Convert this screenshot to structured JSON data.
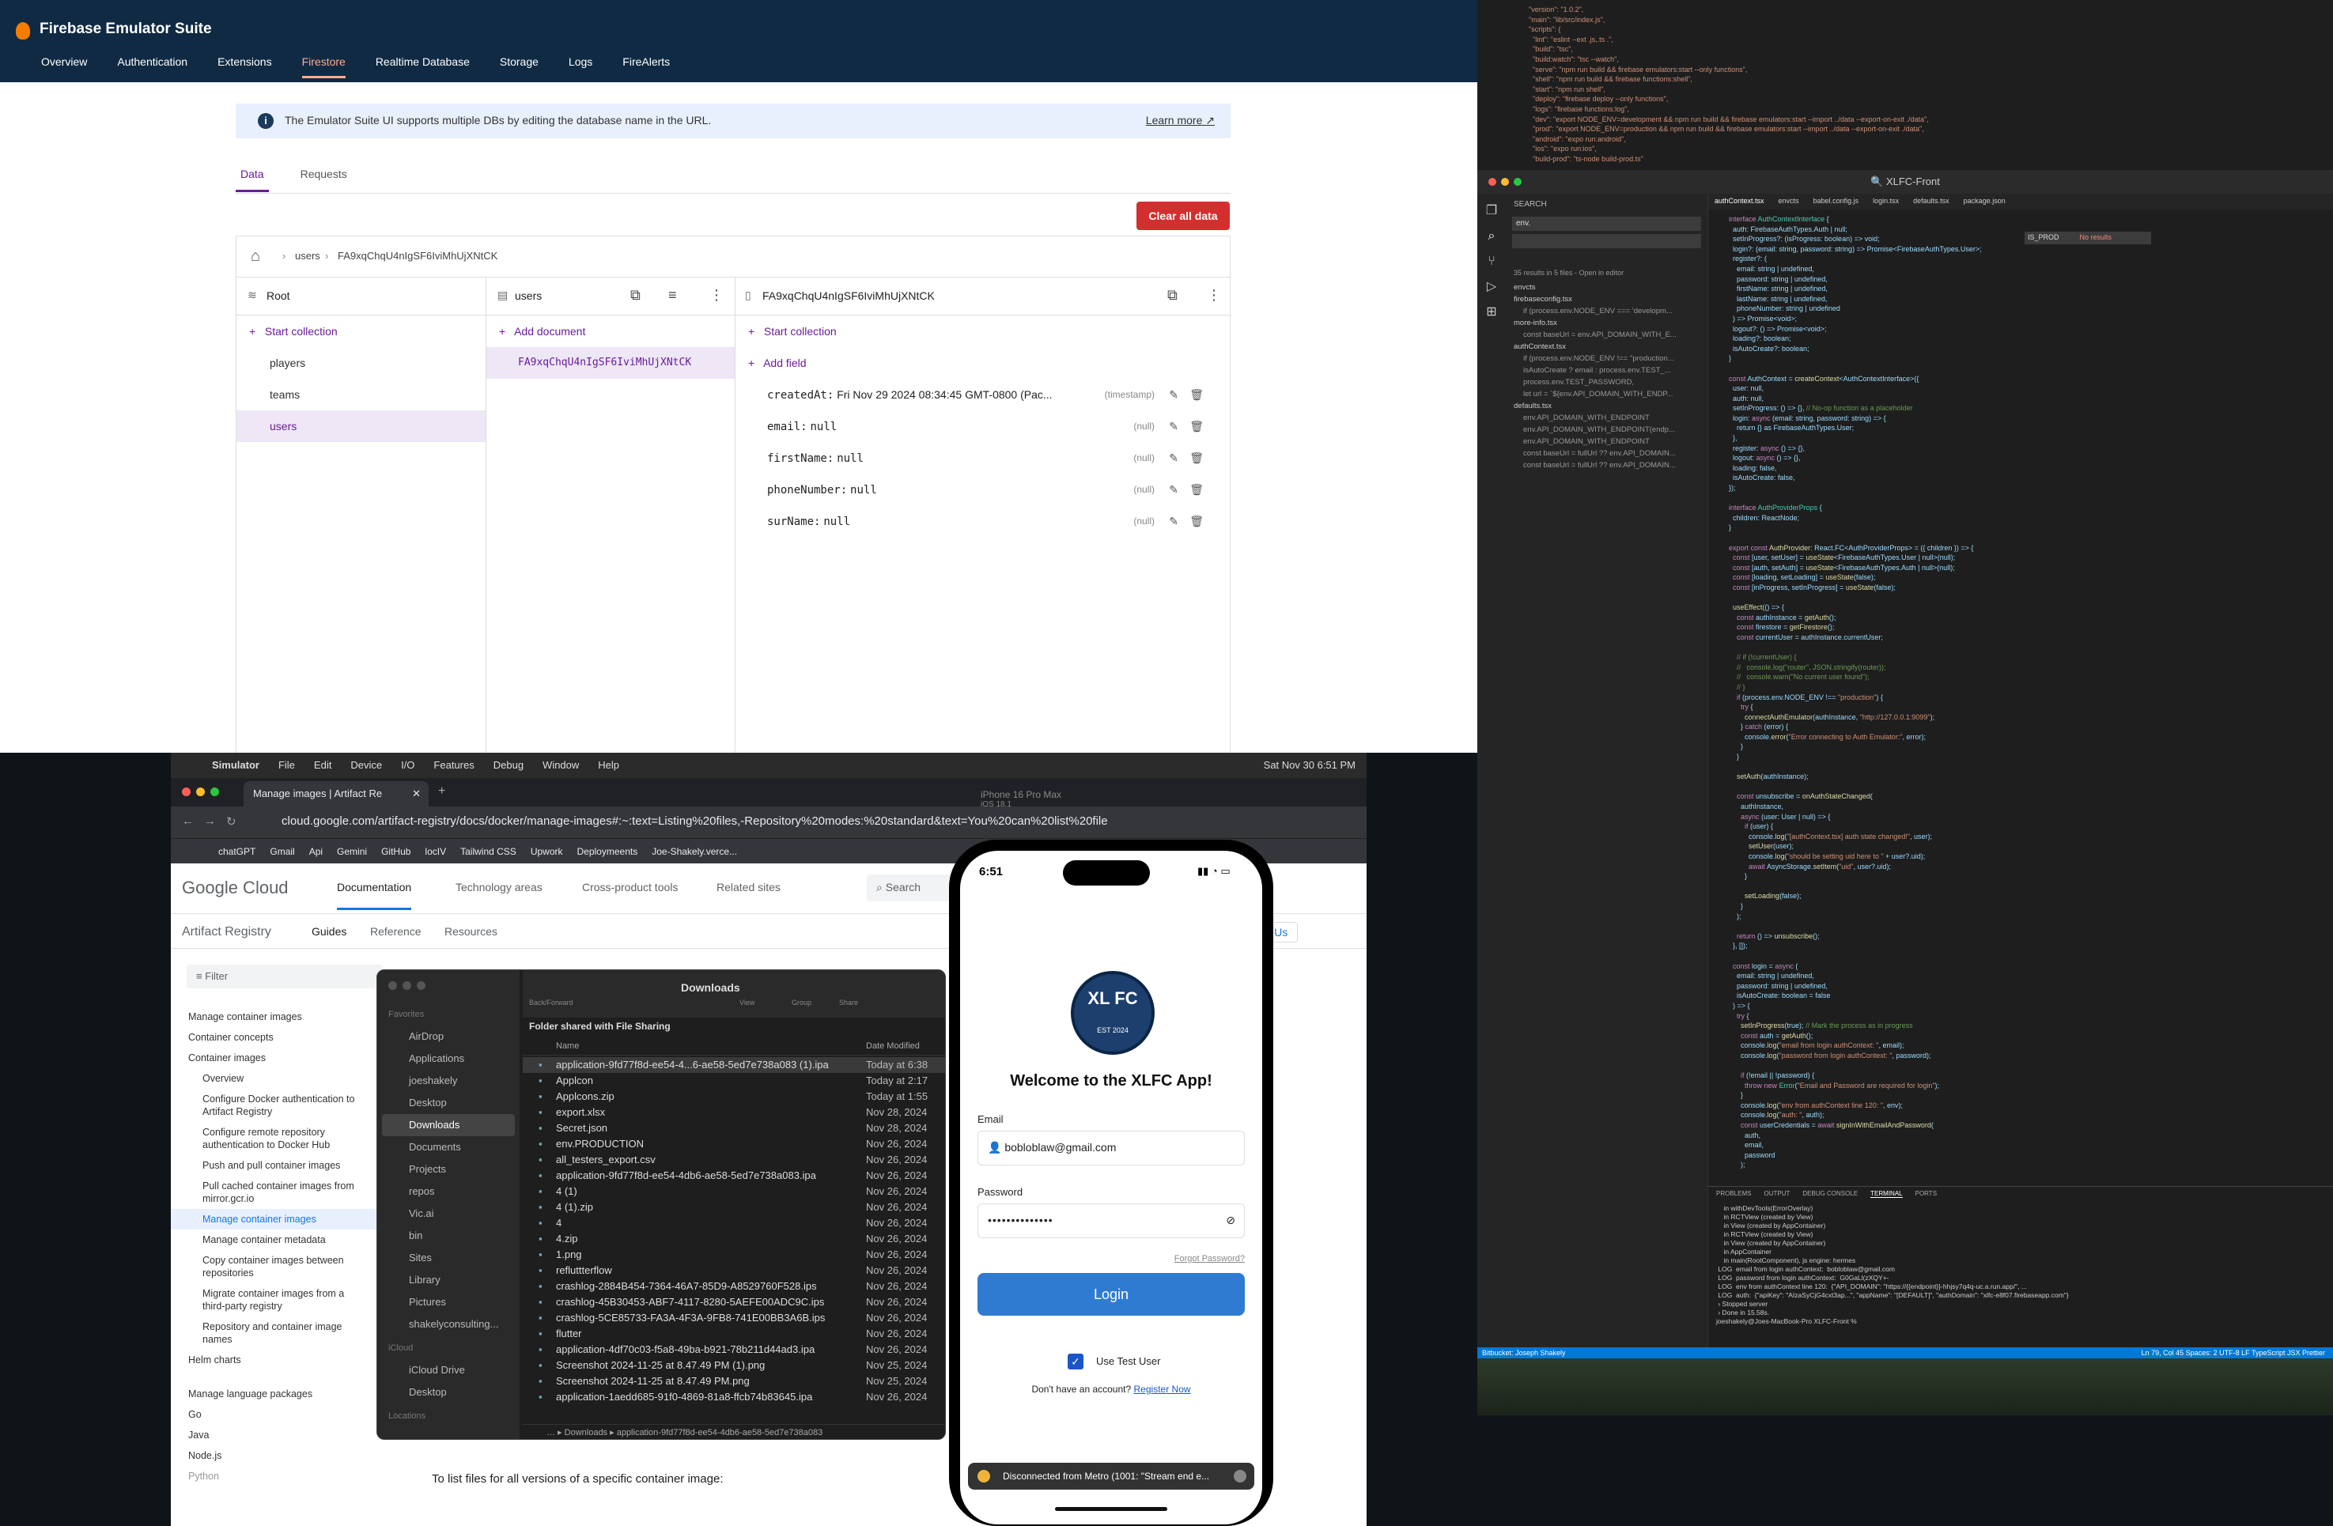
{
  "firebase": {
    "app_title": "Firebase Emulator Suite",
    "nav": [
      "Overview",
      "Authentication",
      "Extensions",
      "Firestore",
      "Realtime Database",
      "Storage",
      "Logs",
      "FireAlerts"
    ],
    "info": "The Emulator Suite UI supports multiple DBs by editing the database name in the URL.",
    "learn_more": "Learn more",
    "tabs": [
      "Data",
      "Requests"
    ],
    "clear_button": "Clear all data",
    "breadcrumb": [
      "users",
      "FA9xqChqU4nIgSF6IviMhUjXNtCK"
    ],
    "root_label": "Root",
    "start_collection": "Start collection",
    "collections": [
      "players",
      "teams",
      "users"
    ],
    "collection_name": "users",
    "add_document": "Add document",
    "document_id": "FA9xqChqU4nIgSF6IviMhUjXNtCK",
    "add_field": "Add field",
    "fields": [
      {
        "key": "createdAt:",
        "value": "Fri Nov 29 2024 08:34:45 GMT-0800 (Pac...",
        "type": "(timestamp)"
      },
      {
        "key": "email:",
        "value": "null",
        "type": "(null)"
      },
      {
        "key": "firstName:",
        "value": "null",
        "type": "(null)"
      },
      {
        "key": "phoneNumber:",
        "value": "null",
        "type": "(null)"
      },
      {
        "key": "surName:",
        "value": "null",
        "type": "(null)"
      }
    ]
  },
  "vscode": {
    "window_title": "XLFC-Front",
    "search_label": "SEARCH",
    "search_query": "env.",
    "replace_query": "IS_PROD",
    "no_results": "No results",
    "results_summary": "35 results in 5 files - Open in editor",
    "files": [
      "envcts",
      "firebaseconfig.tsx",
      "more-info.tsx",
      "authContext.tsx",
      "defaults.tsx"
    ],
    "tabs": [
      "authContext.tsx",
      "envcts",
      "babel.config.js",
      "login.tsx",
      "defaults.tsx",
      "package.json"
    ],
    "panel_tabs": [
      "PROBLEMS",
      "OUTPUT",
      "DEBUG CONSOLE",
      "TERMINAL",
      "PORTS"
    ],
    "status_left": "Bitbucket: Joseph Shakely",
    "status_right": "Ln 79, Col 45  Spaces: 2  UTF-8  LF  TypeScript JSX  Prettier"
  },
  "browser": {
    "menubar": [
      "Simulator",
      "File",
      "Edit",
      "Device",
      "I/O",
      "Features",
      "Debug",
      "Window",
      "Help"
    ],
    "clock": "Sat Nov 30  6:51 PM",
    "tab_title": "Manage images | Artifact Re",
    "url": "cloud.google.com/artifact-registry/docs/docker/manage-images#:~:text=Listing%20files,-Repository%20modes:%20standard&text=You%20can%20list%20file",
    "bookmarks": [
      "chatGPT",
      "Gmail",
      "Api",
      "Gemini",
      "GitHub",
      "locIV",
      "Tailwind CSS",
      "Upwork",
      "Deploymeents",
      "Joe-Shakely.verce..."
    ],
    "gc_logo": "Google Cloud",
    "gc_menu": [
      "Documentation",
      "Technology areas",
      "Cross-product tools",
      "Related sites"
    ],
    "search": "Search",
    "product": "Artifact Registry",
    "subnav": [
      "Guides",
      "Reference",
      "Resources"
    ],
    "contact": "Contact Us",
    "filter": "Filter",
    "nav": [
      "Manage container images",
      "Container concepts",
      "Container images",
      "Overview",
      "Configure Docker authentication to Artifact Registry",
      "Configure remote repository authentication to Docker Hub",
      "Push and pull container images",
      "Pull cached container images from mirror.gcr.io",
      "Manage container images",
      "Manage container metadata",
      "Copy container images between repositories",
      "Migrate container images from a third-party registry",
      "Repository and container image names",
      "Helm charts",
      "Manage language packages",
      "Go",
      "Java",
      "Node.js",
      "Python"
    ],
    "bottom_text": "To list files for all versions of a specific container image:"
  },
  "finder": {
    "title": "Downloads",
    "subtitle": "Folder shared with File Sharing",
    "toolbar": [
      "Back/Forward",
      "View",
      "Group",
      "Share"
    ],
    "favorites_label": "Favorites",
    "sidebar": [
      "AirDrop",
      "Applications",
      "joeshakely",
      "Desktop",
      "Downloads",
      "Documents",
      "Projects",
      "repos",
      "Vic.ai",
      "bin",
      "Sites",
      "Library",
      "Pictures",
      "shakelyconsulting..."
    ],
    "icloud_label": "iCloud",
    "icloud": [
      "iCloud Drive",
      "Desktop"
    ],
    "locations_label": "Locations",
    "col_name": "Name",
    "col_date": "Date Modified",
    "files": [
      {
        "name": "application-9fd77f8d-ee54-4...6-ae58-5ed7e738a083 (1).ipa",
        "date": "Today at 6:38"
      },
      {
        "name": "Applcon",
        "date": "Today at 2:17"
      },
      {
        "name": "Applcons.zip",
        "date": "Today at 1:55"
      },
      {
        "name": "export.xlsx",
        "date": "Nov 28, 2024"
      },
      {
        "name": "Secret.json",
        "date": "Nov 28, 2024"
      },
      {
        "name": "env.PRODUCTION",
        "date": "Nov 26, 2024"
      },
      {
        "name": "all_testers_export.csv",
        "date": "Nov 26, 2024"
      },
      {
        "name": "application-9fd77f8d-ee54-4db6-ae58-5ed7e738a083.ipa",
        "date": "Nov 26, 2024"
      },
      {
        "name": "4 (1)",
        "date": "Nov 26, 2024"
      },
      {
        "name": "4 (1).zip",
        "date": "Nov 26, 2024"
      },
      {
        "name": "4",
        "date": "Nov 26, 2024"
      },
      {
        "name": "4.zip",
        "date": "Nov 26, 2024"
      },
      {
        "name": "1.png",
        "date": "Nov 26, 2024"
      },
      {
        "name": "refluttterflow",
        "date": "Nov 26, 2024"
      },
      {
        "name": "crashlog-2884B454-7364-46A7-85D9-A8529760F528.ips",
        "date": "Nov 26, 2024"
      },
      {
        "name": "crashlog-45B30453-ABF7-4117-8280-5AEFE00ADC9C.ips",
        "date": "Nov 26, 2024"
      },
      {
        "name": "crashlog-5CE85733-FA3A-4F3A-9FB8-741E00BB3A6B.ips",
        "date": "Nov 26, 2024"
      },
      {
        "name": "flutter",
        "date": "Nov 26, 2024"
      },
      {
        "name": "application-4df70c03-f5a8-49ba-b921-78b211d44ad3.ipa",
        "date": "Nov 26, 2024"
      },
      {
        "name": "Screenshot 2024-11-25 at 8.47.49 PM (1).png",
        "date": "Nov 25, 2024"
      },
      {
        "name": "Screenshot 2024-11-25 at 8.47.49 PM.png",
        "date": "Nov 25, 2024"
      },
      {
        "name": "application-1aedd685-91f0-4869-81a8-ffcb74b83645.ipa",
        "date": "Nov 26, 2024"
      }
    ],
    "path": [
      "Downloads",
      "application-9fd77f8d-ee54-4db6-ae58-5ed7e738a083"
    ]
  },
  "iphone": {
    "sim_title": "iPhone 16 Pro Max",
    "sim_sub": "iOS 18.1",
    "time": "6:51",
    "logo_text": "XL FC",
    "logo_est": "EST 2024",
    "welcome": "Welcome to the XLFC App!",
    "email_label": "Email",
    "email_value": "bobloblaw@gmail.com",
    "password_label": "Password",
    "password_value": "••••••••••••••",
    "forgot": "Forgot Password?",
    "login": "Login",
    "test_user": "Use Test User",
    "no_account": "Don't have an account?",
    "register": "Register Now",
    "toast": "Disconnected from Metro (1001: \"Stream end e..."
  }
}
